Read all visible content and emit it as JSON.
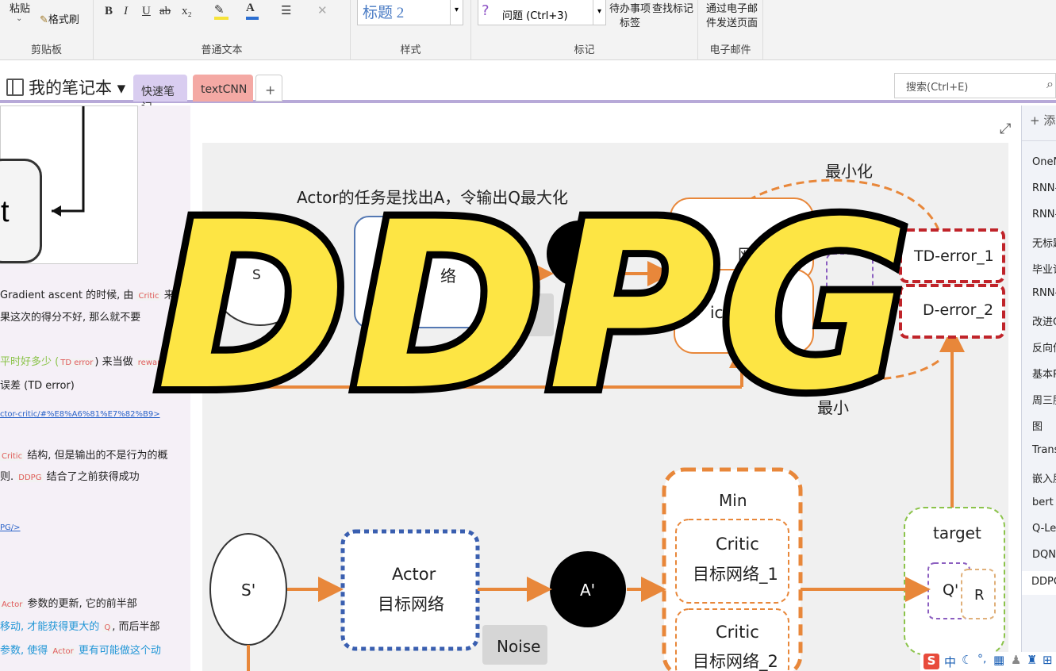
{
  "ribbon": {
    "paste": "粘贴",
    "format_painter": "格式刷",
    "clipboard_label": "剪贴板",
    "bold": "B",
    "italic": "I",
    "underline": "U",
    "strike": "ab",
    "subscript": "x₂",
    "basic_text_label": "普通文本",
    "style_value": "标题 2",
    "styles_label": "样式",
    "tag_value": "问题 (Ctrl+3)",
    "todo_tag": "待办事项",
    "find_tags": "查找标记",
    "tags_suffix": "标签",
    "tags_label": "标记",
    "email_line1": "通过电子邮",
    "email_line2": "件发送页面",
    "email_label": "电子邮件"
  },
  "notebook": {
    "name": "我的笔记本 ▾",
    "tabs": [
      "快速笔记",
      "textCNN"
    ],
    "add_tab": "+"
  },
  "search": {
    "placeholder": "搜索(Ctrl+E)"
  },
  "left": {
    "diagram_letter": "t",
    "p1_a": "Gradient ascent 的时候, 由",
    "p1_b": "Critic",
    "p1_c": "来",
    "p2": "果这次的得分不好, 那么就不要",
    "p3_a": "平时好多少 (",
    "p3_b": "TD error",
    "p3_c": ") 来当做",
    "p3_d": "reward",
    "p4": "误差 (TD error)",
    "link1": "ctor-critic/#%E8%A6%81%E7%82%B9>",
    "p5_a": "Critic",
    "p5_b": "结构, 但是输出的不是行为的概",
    "p6_a": "则.",
    "p6_b": "DDPG",
    "p6_c": "结合了之前获得成功",
    "link2": "PG/>",
    "p7_a": "Actor",
    "p7_b": "参数的更新, 它的前半部",
    "p8_a": "移动, 才能获得更大的",
    "p8_b": "Q",
    "p8_c": ", 而后半部",
    "p9_a": "参数, 使得",
    "p9_b": "Actor",
    "p9_c": "更有可能做这个动"
  },
  "diagram": {
    "top_caption": "Actor的任务是找出A，令输出Q最大化",
    "minimize_top": "最小化",
    "s": "S",
    "actor_top_partial": "络",
    "critic1_partial": "网络_1",
    "critic2_partial": "ic网络",
    "td1": "TD-error_1",
    "td2": "D-error_2",
    "minimize_bottom": "最小",
    "s_prime": "S'",
    "actor_target_1": "Actor",
    "actor_target_2": "目标网络",
    "a_prime": "A'",
    "noise": "Noise",
    "min": "Min",
    "critic_t1_1": "Critic",
    "critic_t1_2": "目标网络_1",
    "critic_t2_1": "Critic",
    "critic_t2_2": "目标网络_2",
    "target": "target",
    "q_prime": "Q'",
    "r": "R"
  },
  "overlay_title": "DDPG",
  "right": {
    "add": "+ 添",
    "pages": [
      "OneN",
      "RNN-",
      "RNN-",
      "无标题",
      "毕业论",
      "RNN-",
      "改进C",
      "反向传",
      "基本R",
      "周三股",
      "图",
      "Trans",
      "嵌入层",
      "bert",
      "Q-Lea",
      "DQN",
      "DDPG"
    ]
  },
  "ime": {
    "label": "中"
  },
  "colors": {
    "accent": "#7b6fb5",
    "orange": "#e8873a",
    "red_dash": "#c0242a",
    "yellow": "#fde544",
    "tab_quick": "#d9cdf0",
    "tab_textcnn": "#f4a9a4"
  }
}
